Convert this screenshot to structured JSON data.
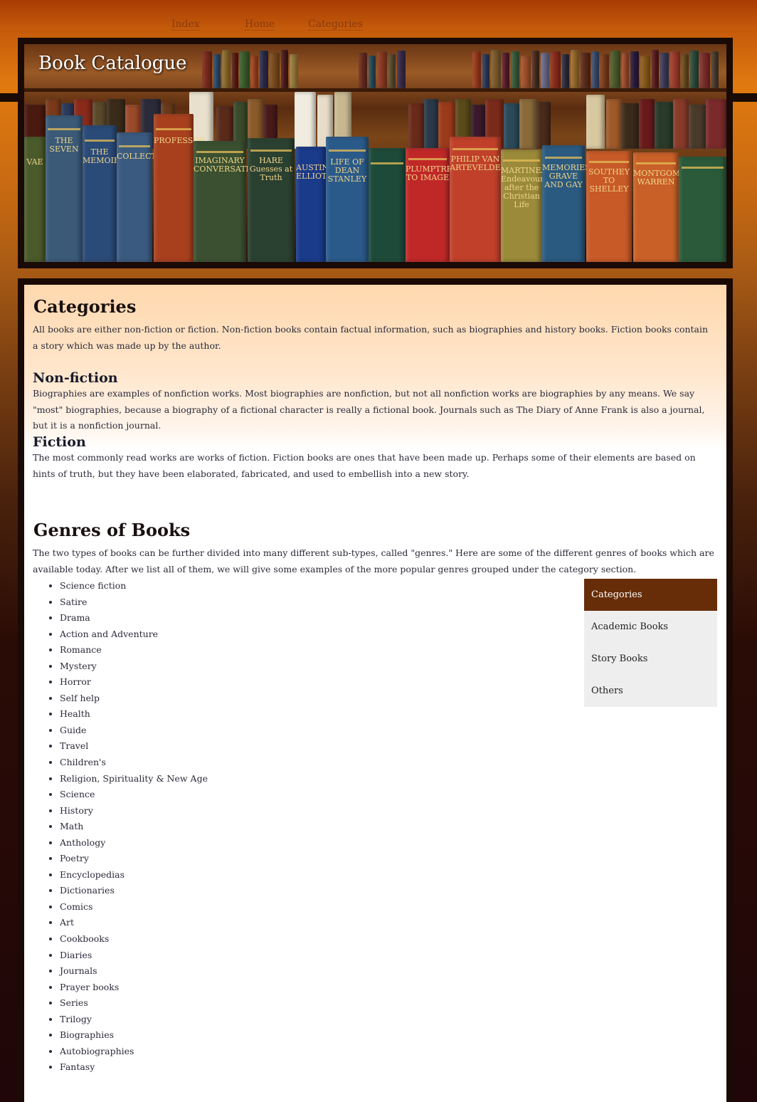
{
  "nav": {
    "links": [
      "Index",
      "Home",
      "Categories"
    ]
  },
  "banner": {
    "title": "Book Catalogue"
  },
  "content": {
    "categories": {
      "heading": "Categories",
      "text": "All books are either non-fiction or fiction. Non-fiction books contain factual information, such as biographies and history books. Fiction books contain a story which was made up by the author."
    },
    "nonfiction": {
      "heading": "Non-fiction",
      "text": "Biographies are examples of nonfiction works. Most biographies are nonfiction, but not all nonfiction works are biographies by any means. We say \"most\" biographies, because a biography of a fictional character is really a fictional book. Journals such as The Diary of Anne Frank is also a journal, but it is a nonfiction journal."
    },
    "fiction": {
      "heading": "Fiction",
      "text": "The most commonly read works are works of fiction. Fiction books are ones that have been made up. Perhaps some of their elements are based on hints of truth, but they have been elaborated, fabricated, and used to embellish into a new story."
    },
    "genres": {
      "heading": "Genres of Books",
      "text": "The two types of books can be further divided into many different sub-types, called \"genres.\" Here are some of the different genres of books which are available today. After we list all of them, we will give some examples of the more popular genres grouped under the category section.",
      "items": [
        "Science fiction",
        "Satire",
        "Drama",
        "Action and Adventure",
        "Romance",
        "Mystery",
        "Horror",
        "Self help",
        "Health",
        "Guide",
        "Travel",
        "Children's",
        "Religion, Spirituality & New Age",
        "Science",
        "History",
        "Math",
        "Anthology",
        "Poetry",
        "Encyclopedias",
        "Dictionaries",
        "Comics",
        "Art",
        "Cookbooks",
        "Diaries",
        "Journals",
        "Prayer books",
        "Series",
        "Trilogy",
        "Biographies",
        "Autobiographies",
        "Fantasy"
      ]
    }
  },
  "sidemenu": {
    "items": [
      "Categories",
      "Academic Books",
      "Story Books",
      "Others"
    ],
    "active_color": "#662d08"
  },
  "spines": [
    "VAE",
    "THE SEVEN",
    "THE MEMOIRES",
    "COLLECTIONS",
    "PROFESSOR",
    "IMAGINARY CONVERSATIONS",
    "HARE Guesses at Truth",
    "AUSTIN ELLIOT",
    "LIFE OF DEAN STANLEY",
    "",
    "PLUMPTRE TO IMAGE",
    "PHILIP VAN ARTEVELDE",
    "MARTINEAU Endeavours after the Christian Life",
    "MEMORIES GRAVE AND GAY",
    "SOUTHEY TO SHELLEY",
    "MONTGOMERY WARREN",
    ""
  ]
}
